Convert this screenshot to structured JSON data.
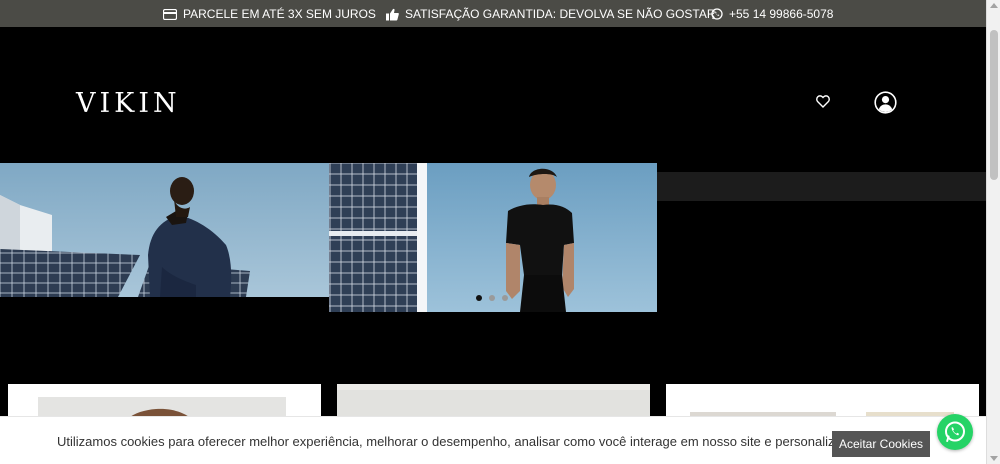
{
  "topbar": {
    "items": [
      {
        "icon": "credit-card-icon",
        "label": "PARCELE EM ATÉ 3X SEM JUROS"
      },
      {
        "icon": "thumbs-up-icon",
        "label": "SATISFAÇÃO GARANTIDA: DEVOLVA SE NÃO GOSTAR"
      },
      {
        "icon": "whatsapp-icon",
        "label": "+55 14 99866-5078"
      }
    ]
  },
  "header": {
    "logo": "VIKIN",
    "icons": [
      "heart-icon",
      "user-icon"
    ]
  },
  "banner": {
    "slides": 3,
    "active_slide": 1
  },
  "cookie_bar": {
    "text": "Utilizamos cookies para oferecer melhor experiência, melhorar o desempenho, analisar como você interage em nosso site e personalizar conteúdo.",
    "button": "Aceitar Cookies"
  },
  "colors": {
    "topbar_bg": "#4b4b46",
    "page_bg": "#000000",
    "cookie_button_bg": "#555555",
    "whatsapp_green": "#25d366"
  }
}
